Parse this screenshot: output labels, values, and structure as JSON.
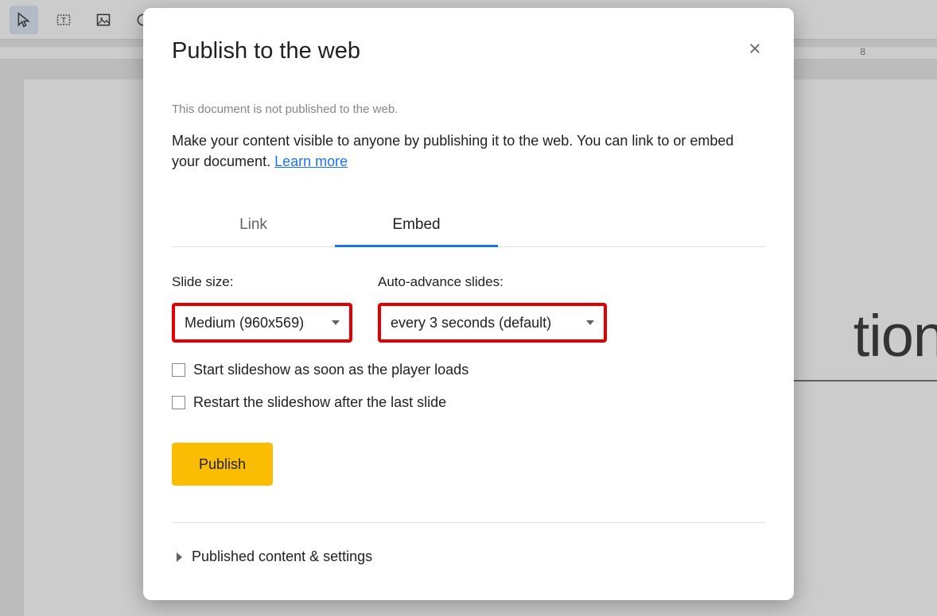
{
  "background": {
    "ruler_mark": "8",
    "title_fragment": "tion"
  },
  "dialog": {
    "title": "Publish to the web",
    "status": "This document is not published to the web.",
    "description": "Make your content visible to anyone by publishing it to the web. You can link to or embed your document. ",
    "learn_more": "Learn more",
    "tabs": {
      "link": "Link",
      "embed": "Embed"
    },
    "slide_size_label": "Slide size:",
    "slide_size_value": "Medium (960x569)",
    "auto_advance_label": "Auto-advance slides:",
    "auto_advance_value": "every 3 seconds (default)",
    "checkbox_start": "Start slideshow as soon as the player loads",
    "checkbox_restart": "Restart the slideshow after the last slide",
    "publish_button": "Publish",
    "expand_section": "Published content & settings"
  }
}
